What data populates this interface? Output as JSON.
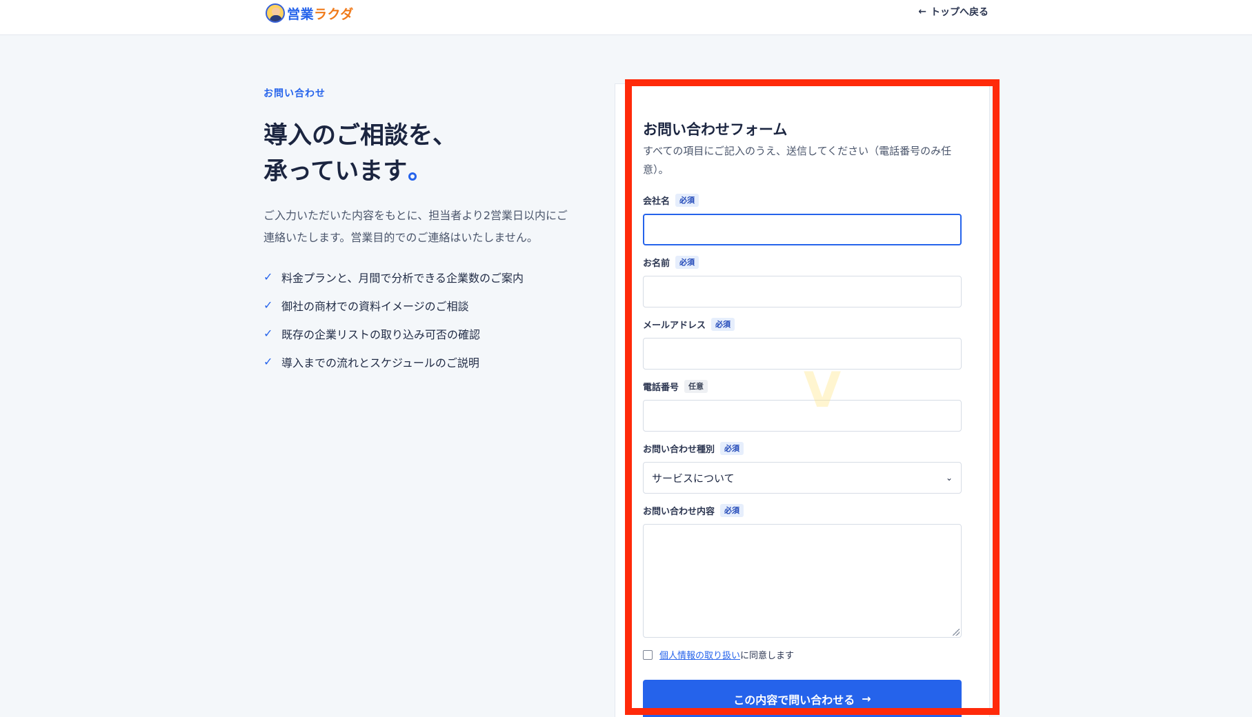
{
  "header": {
    "logo_text_a": "営業",
    "logo_text_b": "ラクダ",
    "back_link": "トップへ戻る"
  },
  "left": {
    "eyebrow": "お問い合わせ",
    "headline_line1": "導入のご相談を、",
    "headline_line2": "承っています",
    "intro": "ご入力いただいた内容をもとに、担当者より2営業日以内にご連絡いたします。営業目的でのご連絡はいたしません。",
    "checklist": [
      "料金プランと、月間で分析できる企業数のご案内",
      "御社の商材での資料イメージのご相談",
      "既存の企業リストの取り込み可否の確認",
      "導入までの流れとスケジュールのご説明"
    ]
  },
  "form": {
    "title": "お問い合わせフォーム",
    "description": "すべての項目にご記入のうえ、送信してください（電話番号のみ任意）。",
    "fields": {
      "company": {
        "label": "会社名",
        "badge": "必須",
        "value": ""
      },
      "name": {
        "label": "お名前",
        "badge": "必須",
        "value": ""
      },
      "email": {
        "label": "メールアドレス",
        "badge": "必須",
        "value": ""
      },
      "phone": {
        "label": "電話番号",
        "badge": "任意",
        "value": ""
      },
      "type": {
        "label": "お問い合わせ種別",
        "badge": "必須",
        "selected": "サービスについて"
      },
      "message": {
        "label": "お問い合わせ内容",
        "badge": "必須",
        "value": ""
      }
    },
    "consent_link": "個人情報の取り扱い",
    "consent_text": "に同意します",
    "submit_label": "この内容で問い合わせる"
  },
  "colors": {
    "accent": "#2563eb",
    "highlight": "#ff2a0a",
    "brand_orange": "#f07a1a"
  }
}
